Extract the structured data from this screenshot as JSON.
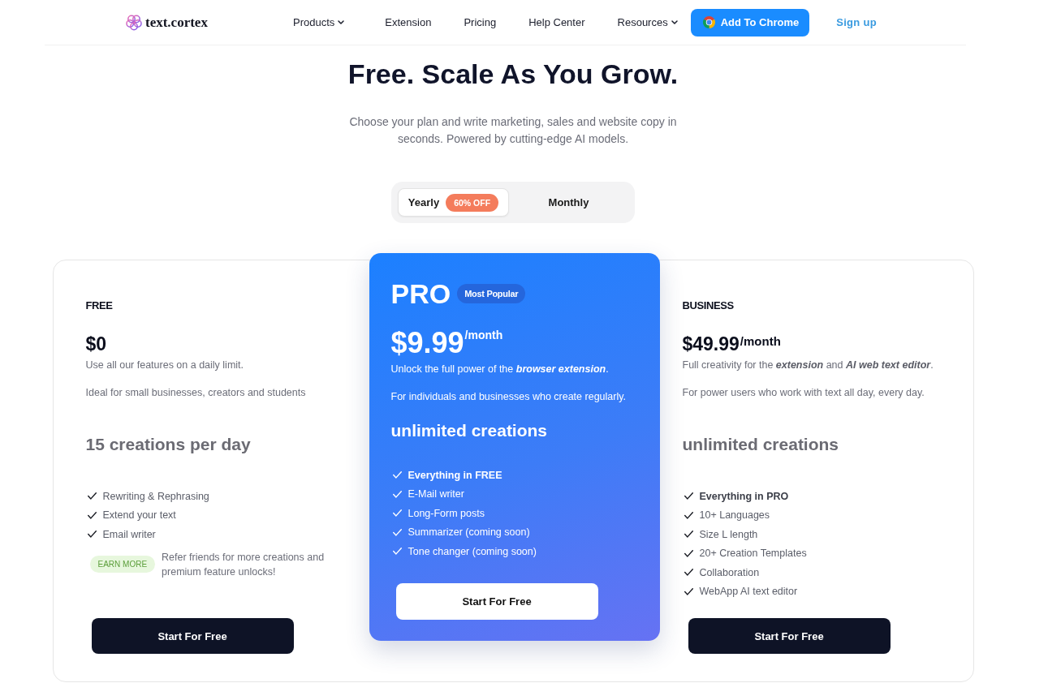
{
  "header": {
    "logo": "text.cortex",
    "nav": [
      {
        "label": "Products",
        "dropdown": true
      },
      {
        "label": "Extension",
        "dropdown": false
      },
      {
        "label": "Pricing",
        "dropdown": false
      },
      {
        "label": "Help Center",
        "dropdown": false
      },
      {
        "label": "Resources",
        "dropdown": true
      }
    ],
    "cta_button": "Add To Chrome",
    "sign_up": "Sign up"
  },
  "hero": {
    "title": "Free. Scale As You Grow.",
    "subtitle": "Choose your plan and write marketing, sales and website copy in seconds. Powered by cutting-edge AI models."
  },
  "billing_toggle": [
    {
      "label": "Yearly",
      "badge": "60% OFF",
      "selected": true
    },
    {
      "label": "Monthly",
      "selected": false
    }
  ],
  "plans": [
    {
      "kind": "standard",
      "name": "FREE",
      "price": "$0",
      "description": "Use all our features on a daily limit.",
      "audience": "Ideal for small businesses, creators and students",
      "quota": "15 creations per day",
      "features": [
        {
          "label": "Rewriting & Rephrasing",
          "bold": false
        },
        {
          "label": "Extend your text",
          "bold": false
        },
        {
          "label": "Email writer",
          "bold": false
        }
      ],
      "promo": {
        "badge": "EARN MORE",
        "text": "Refer friends for more creations and premium feature unlocks!"
      },
      "button": "Start For Free"
    },
    {
      "kind": "featured",
      "name": "PRO",
      "badge": "Most Popular",
      "price": "$9.99",
      "period": "/month",
      "description": "Unlock the full power of the **browser extension**.",
      "audience": "For individuals and businesses who create regularly.",
      "quota": "unlimited creations",
      "features": [
        {
          "label": "Everything in FREE",
          "bold": true
        },
        {
          "label": "E-Mail writer",
          "bold": false
        },
        {
          "label": "Long-Form posts",
          "bold": false
        },
        {
          "label": "Summarizer (coming soon)",
          "bold": false
        },
        {
          "label": "Tone changer (coming soon)",
          "bold": false
        }
      ],
      "button": "Start For Free"
    },
    {
      "kind": "standard",
      "name": "BUSINESS",
      "price": "$49.99",
      "period": "/month",
      "description": "Full creativity for the **extension** and **AI web text editor**.",
      "audience": "For power users who work with text all day, every day.",
      "quota": "unlimited creations",
      "features": [
        {
          "label": "Everything in PRO",
          "bold": true
        },
        {
          "label": "10+ Languages",
          "bold": false
        },
        {
          "label": "Size L length",
          "bold": false
        },
        {
          "label": "20+ Creation Templates",
          "bold": false
        },
        {
          "label": "Collaboration",
          "bold": false
        },
        {
          "label": "WebApp AI text editor",
          "bold": false
        }
      ],
      "button": "Start For Free"
    }
  ]
}
